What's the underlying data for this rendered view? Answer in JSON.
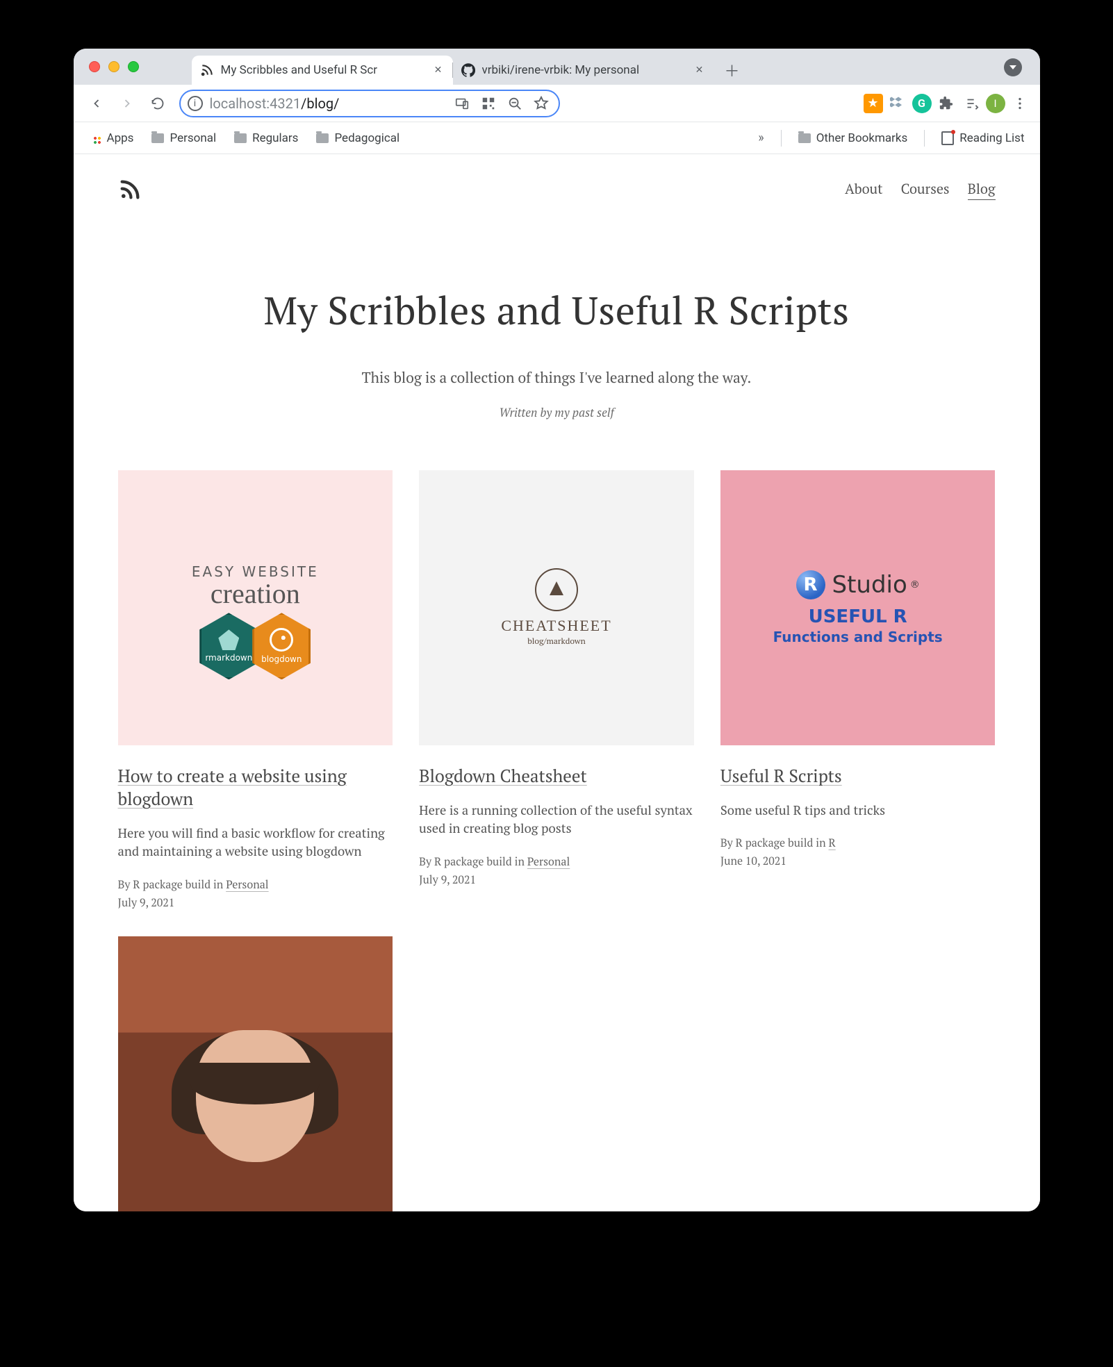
{
  "browser": {
    "tabs": [
      {
        "title": "My Scribbles and Useful R Scr",
        "active": true
      },
      {
        "title": "vrbiki/irene-vrbik: My personal",
        "active": false
      }
    ],
    "url_host": "localhost",
    "url_port": ":4321",
    "url_path": "/blog/",
    "avatar_initial": "I",
    "bookmarks": {
      "apps": "Apps",
      "folders": [
        "Personal",
        "Regulars",
        "Pedagogical"
      ],
      "other": "Other Bookmarks",
      "reading": "Reading List",
      "overflow": "»"
    }
  },
  "site": {
    "nav": [
      "About",
      "Courses",
      "Blog"
    ],
    "nav_active": "Blog",
    "title": "My Scribbles and Useful R Scripts",
    "subtitle": "This blog is a collection of things I've learned along the way.",
    "byline": "Written by my past self"
  },
  "posts": [
    {
      "title": "How to create a website using blogdown",
      "desc": "Here you will find a basic workflow for creating and maintaining a website using blogdown",
      "author_prefix": "By R package build in ",
      "category": "Personal",
      "date": "July 9, 2021",
      "thumb": "t1",
      "thumb_text": {
        "l1": "EASY WEBSITE",
        "l2": "creation",
        "hex1": "rmarkdown",
        "hex2": "blogdown"
      }
    },
    {
      "title": "Blogdown Cheatsheet",
      "desc": "Here is a running collection of the useful syntax used in creating blog posts",
      "author_prefix": "By R package build in ",
      "category": "Personal",
      "date": "July 9, 2021",
      "thumb": "t2",
      "thumb_text": {
        "big": "CHEATSHEET",
        "sm": "blog/markdown"
      }
    },
    {
      "title": "Useful R Scripts",
      "desc": "Some useful R tips and tricks",
      "author_prefix": "By R package build in ",
      "category": "R",
      "date": "June 10, 2021",
      "thumb": "t3",
      "thumb_text": {
        "row1": "Studio",
        "row2": "USEFUL R",
        "row3": "Functions and Scripts"
      }
    },
    {
      "title": "",
      "desc": "",
      "author_prefix": "",
      "category": "",
      "date": "",
      "thumb": "t4"
    }
  ]
}
